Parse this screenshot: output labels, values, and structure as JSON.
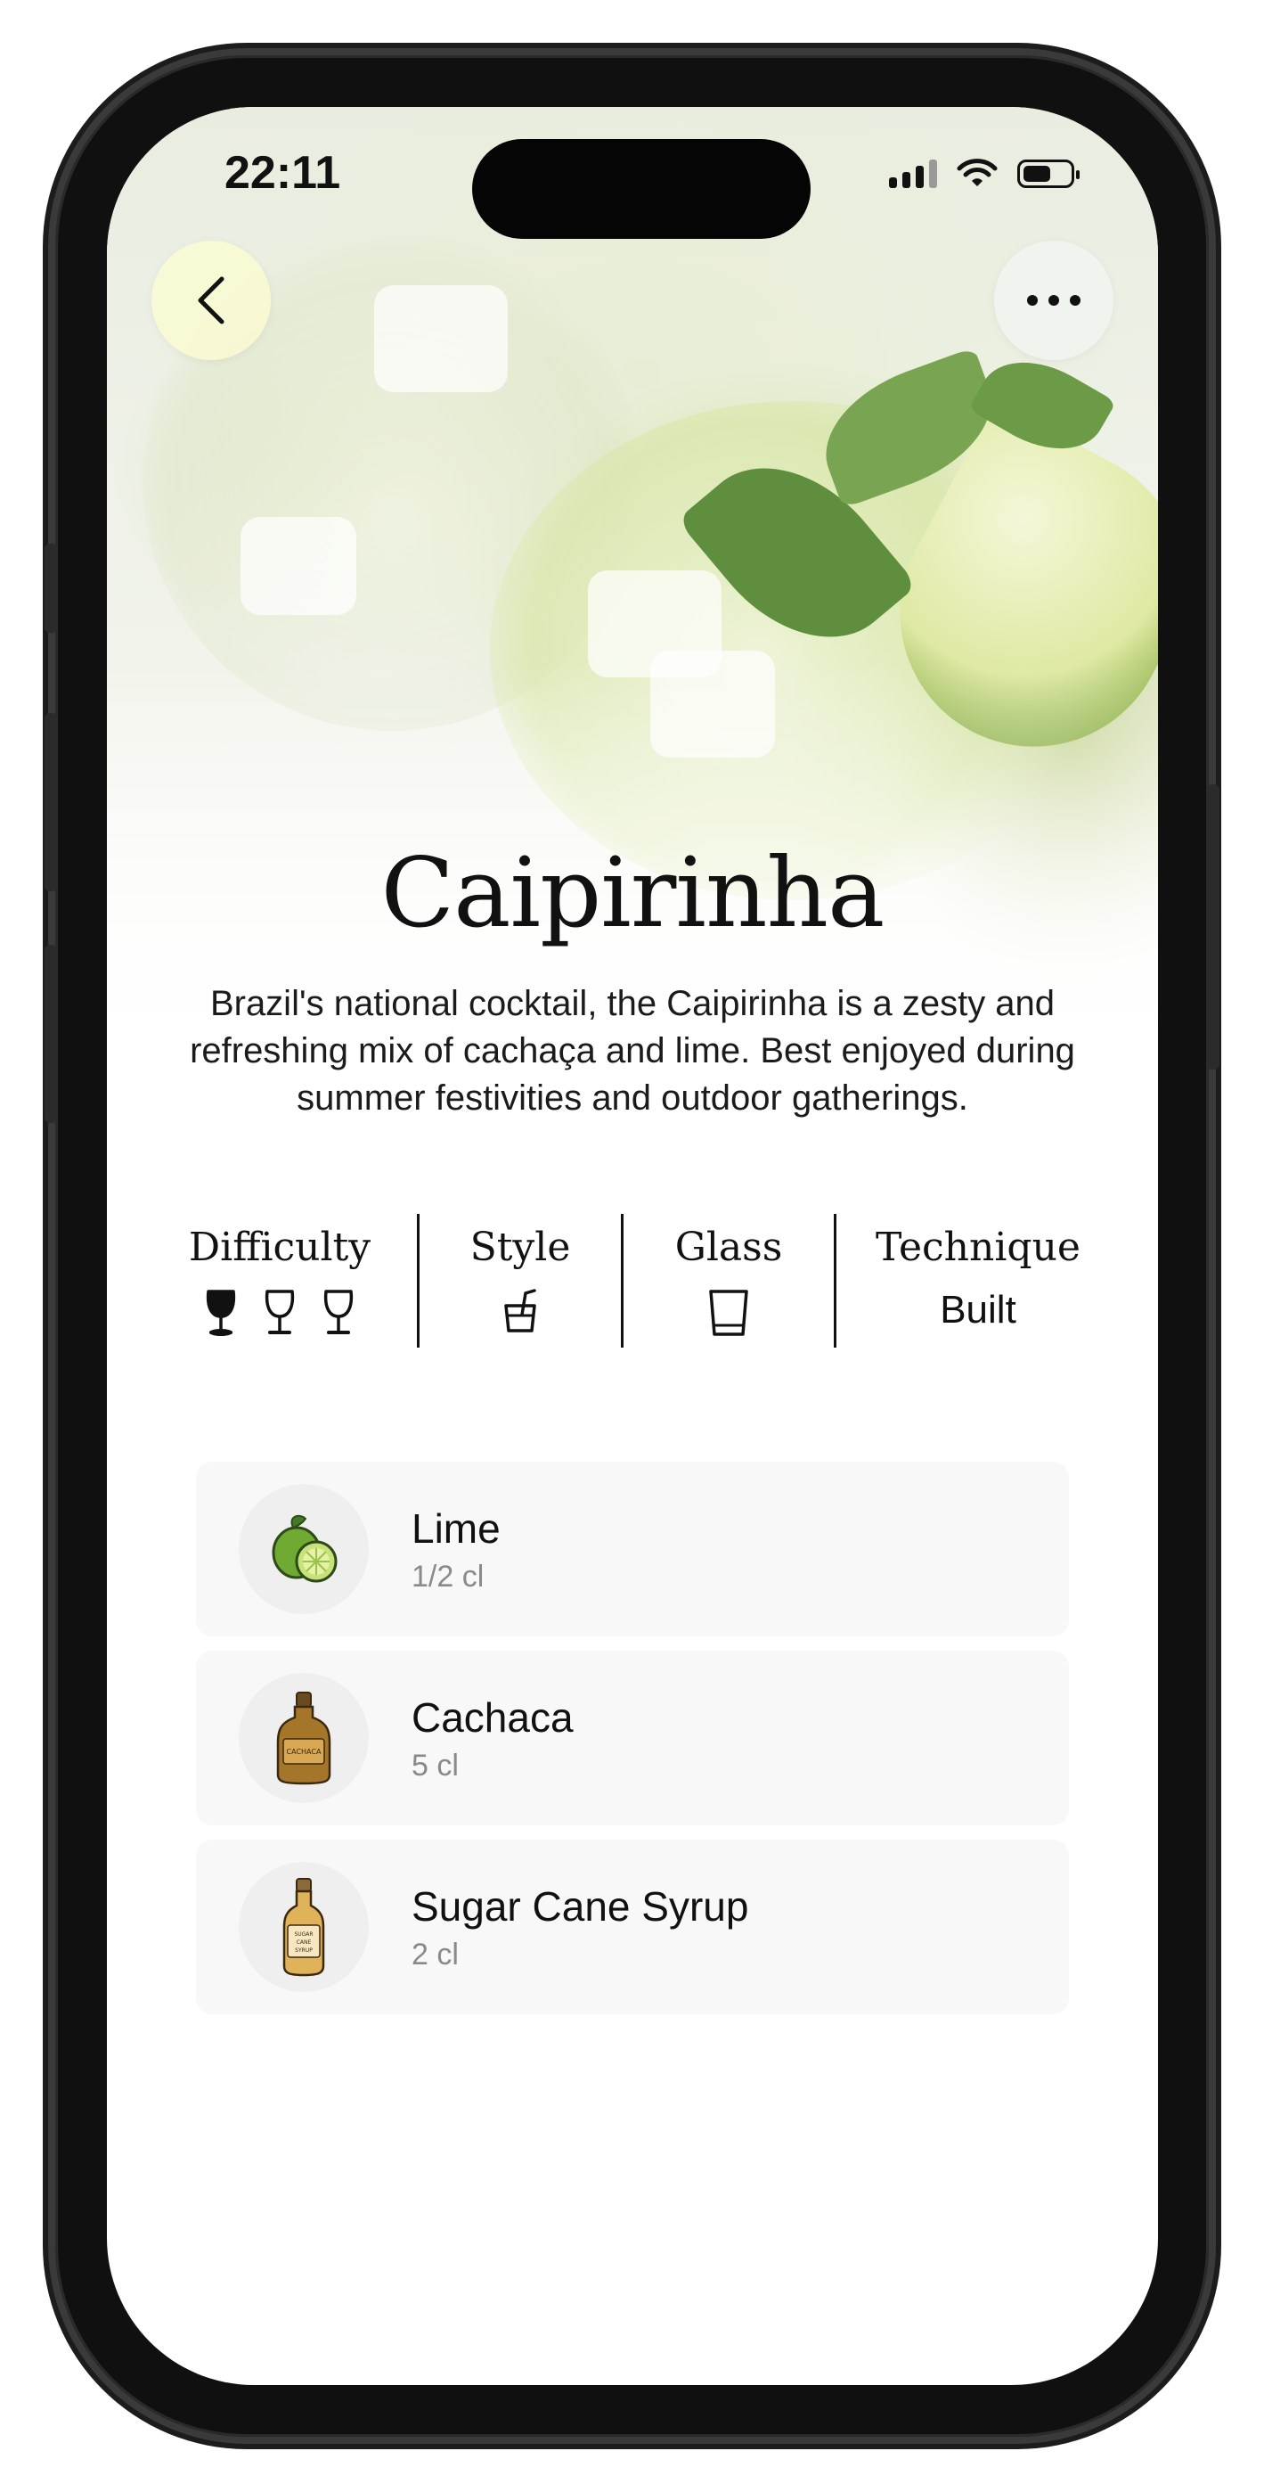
{
  "status_bar": {
    "time": "22:11"
  },
  "recipe": {
    "title": "Caipirinha",
    "description": "Brazil's national cocktail, the Caipirinha is a zesty and refreshing mix of cachaça and lime. Best enjoyed during summer festivities and outdoor gatherings."
  },
  "stats": {
    "difficulty": {
      "label": "Difficulty",
      "level": 1,
      "max": 3
    },
    "style": {
      "label": "Style",
      "icon": "tumbler-straw-icon"
    },
    "glass": {
      "label": "Glass",
      "icon": "rocks-glass-icon"
    },
    "technique": {
      "label": "Technique",
      "value": "Built"
    }
  },
  "ingredients": [
    {
      "name": "Lime",
      "amount": "1/2 cl",
      "icon": "lime-icon"
    },
    {
      "name": "Cachaca",
      "amount": "5 cl",
      "icon": "cachaca-bottle-icon",
      "bottle_label": "CACHACA"
    },
    {
      "name": "Sugar Cane Syrup",
      "amount": "2 cl",
      "icon": "syrup-bottle-icon",
      "bottle_label": "SUGAR CANE SYRUP"
    }
  ],
  "colors": {
    "lime_green": "#7dbb3c",
    "bottle_brown": "#a5752a",
    "syrup_amber": "#e0b35a"
  }
}
